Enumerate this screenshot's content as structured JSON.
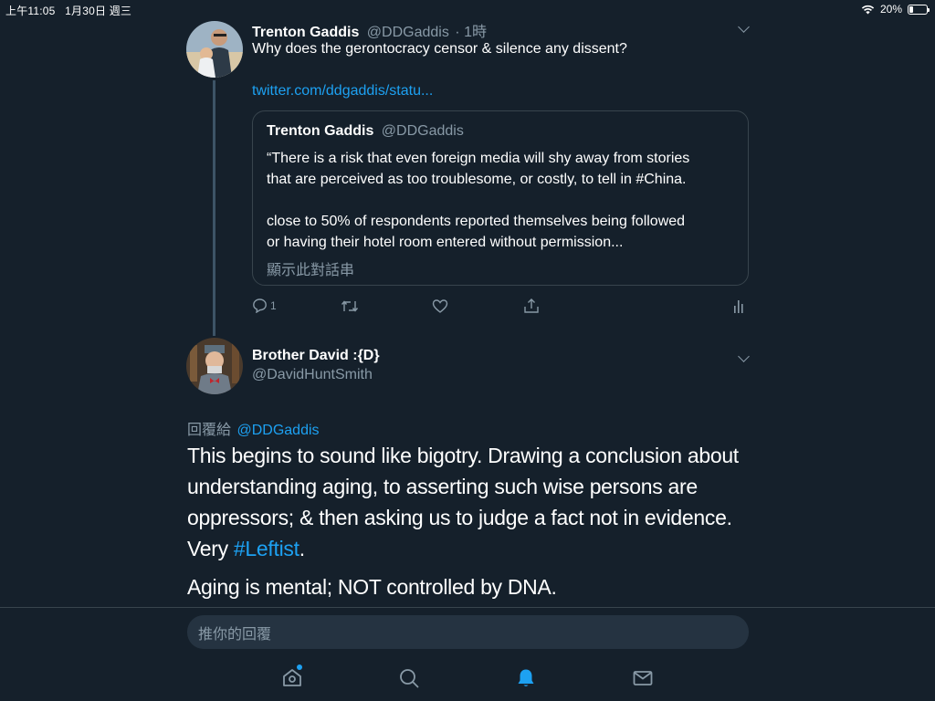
{
  "status_bar": {
    "time_date": "上午11:05   1月30日 週三",
    "battery_percent": "20%",
    "battery_level": 0.2
  },
  "tweet1": {
    "name": "Trenton Gaddis",
    "handle": "@DDGaddis",
    "time": "· 1時",
    "text": "Why does the gerontocracy censor & silence any dissent?",
    "link": "twitter.com/ddgaddis/statu...",
    "quote": {
      "name": "Trenton Gaddis",
      "handle": "@DDGaddis",
      "line1": "“There is a risk that even foreign media will shy away from stories",
      "line2": "that are perceived as too troublesome, or costly, to tell in #China.",
      "line3": "close to 50% of respondents reported themselves being followed",
      "line4": "or having their hotel room entered without permission...",
      "show_thread": "顯示此對話串"
    },
    "reply_count": "1"
  },
  "tweet2": {
    "name": "Brother David :{D}",
    "handle": "@DavidHuntSmith",
    "reply_to_label": "回覆給",
    "reply_to_handle": "@DDGaddis",
    "line1": "This begins to sound like bigotry. Drawing a conclusion about",
    "line2": "understanding aging, to asserting such wise persons are",
    "line3": "oppressors; & then asking us to judge a fact not in evidence.",
    "line4_prefix": "Very ",
    "line4_hashtag": "#Leftist",
    "line4_suffix": ".",
    "line5": "Aging is mental; NOT controlled by DNA."
  },
  "composer": {
    "placeholder": "推你的回覆"
  },
  "tabs": [
    {
      "icon": "home-icon"
    },
    {
      "icon": "search-icon"
    },
    {
      "icon": "notifications-icon",
      "active": true
    },
    {
      "icon": "messages-icon"
    }
  ],
  "colors": {
    "background": "#15202b",
    "accent": "#1da1f2",
    "secondary_text": "#8899a6",
    "border": "#38444d"
  }
}
